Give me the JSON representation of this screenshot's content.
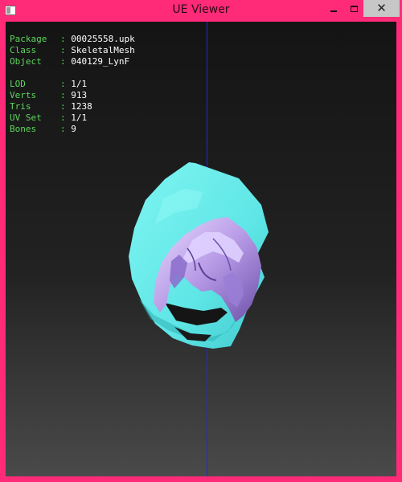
{
  "window": {
    "title": "UE Viewer",
    "controls": {
      "minimize": "minimize-icon",
      "maximize": "maximize-icon",
      "close": "close-icon"
    },
    "frame_color": "#ff2a78"
  },
  "viewer": {
    "object_info": [
      {
        "label": "Package",
        "value": "00025558.upk"
      },
      {
        "label": "Class  ",
        "value": "SkeletalMesh"
      },
      {
        "label": "Object ",
        "value": "040129_LynF"
      }
    ],
    "mesh_info": [
      {
        "label": "LOD    ",
        "value": "1/1"
      },
      {
        "label": "Verts  ",
        "value": "913"
      },
      {
        "label": "Tris   ",
        "value": "1238"
      },
      {
        "label": "UV Set ",
        "value": "1/1"
      },
      {
        "label": "Bones  ",
        "value": "9"
      }
    ],
    "label_color": "#5cd65c",
    "value_color": "#ffffff",
    "axis_color": "#1d2bd6",
    "mesh_colors": {
      "hood": "#6ff0ee",
      "hair": "#b9a3e6"
    }
  }
}
